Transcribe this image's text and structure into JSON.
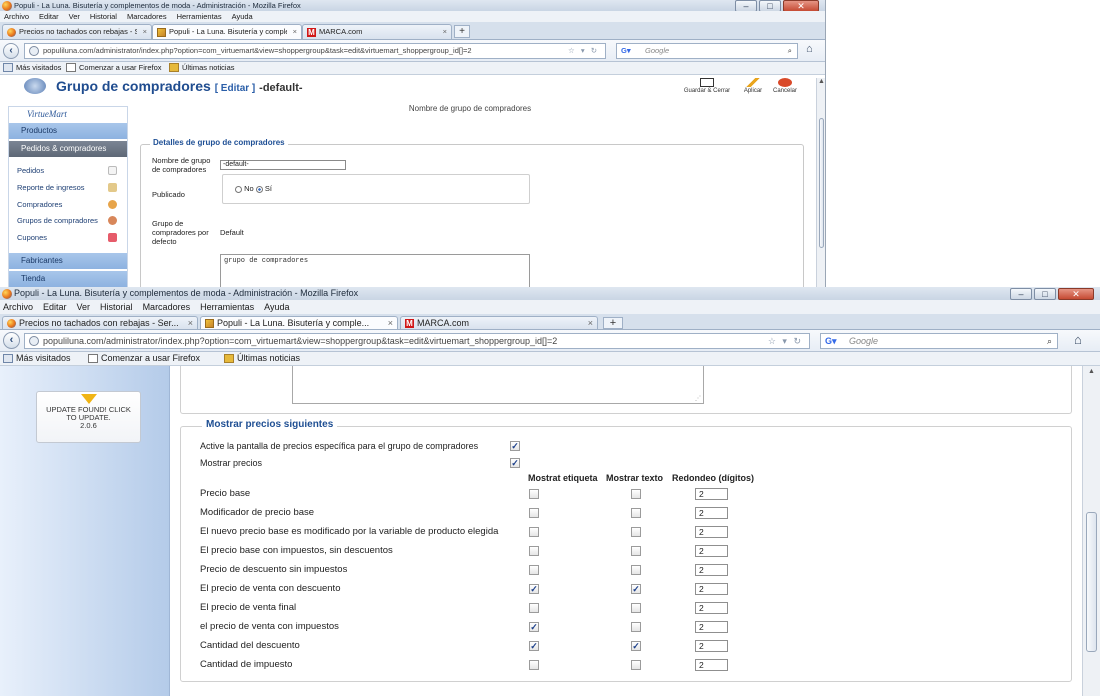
{
  "top_window": {
    "title": "Populi - La Luna. Bisutería y complementos de moda - Administración - Mozilla Firefox",
    "menu": [
      "Archivo",
      "Editar",
      "Ver",
      "Historial",
      "Marcadores",
      "Herramientas",
      "Ayuda"
    ],
    "tabs": [
      {
        "label": "Precios no tachados con rebajas - Ser...",
        "icon": "firefox-icon"
      },
      {
        "label": "Populi - La Luna. Bisutería y comple...",
        "icon": "image-icon"
      },
      {
        "label": "MARCA.com",
        "icon": "marca-icon"
      }
    ],
    "url": "populiluna.com/administrator/index.php?option=com_virtuemart&view=shoppergroup&task=edit&virtuemart_shoppergroup_id[]=2",
    "search_placeholder": "Google",
    "bookmarks": [
      "Más visitados",
      "Comenzar a usar Firefox",
      "Últimas noticias"
    ],
    "page_title": "Grupo de compradores",
    "page_title_edit": "[ Editar ]",
    "page_title_name": "-default-",
    "toolbar": [
      "Guardar & Cerrar",
      "Aplicar",
      "Cancelar"
    ],
    "sidebar": {
      "logo": "VirtueMart",
      "sections": [
        "Productos",
        "Pedidos & compradores",
        "Fabricantes",
        "Tienda"
      ],
      "links": [
        "Pedidos",
        "Reporte de ingresos",
        "Compradores",
        "Grupos de compradores",
        "Cupones"
      ]
    },
    "column_header": "Nombre de grupo de compradores",
    "fieldset_legend": "Detalles de grupo de compradores",
    "field_name_label": "Nombre de grupo de compradores",
    "field_name_value": "-default-",
    "published_label": "Publicado",
    "radio_no": "No",
    "radio_si": "Sí",
    "default_label": "Grupo de compradores por defecto",
    "default_value": "Default",
    "description_value": "grupo de compradores"
  },
  "bottom_window": {
    "title": "Populi - La Luna. Bisutería y complementos de moda - Administración - Mozilla Firefox",
    "menu": [
      "Archivo",
      "Editar",
      "Ver",
      "Historial",
      "Marcadores",
      "Herramientas",
      "Ayuda"
    ],
    "tabs": [
      {
        "label": "Precios no tachados con rebajas - Ser...",
        "icon": "firefox-icon"
      },
      {
        "label": "Populi - La Luna. Bisutería y comple...",
        "icon": "image-icon"
      },
      {
        "label": "MARCA.com",
        "icon": "marca-icon"
      }
    ],
    "url": "populiluna.com/administrator/index.php?option=com_virtuemart&view=shoppergroup&task=edit&virtuemart_shoppergroup_id[]=2",
    "search_placeholder": "Google",
    "bookmarks": [
      "Más visitados",
      "Comenzar a usar Firefox",
      "Últimas noticias"
    ],
    "update_box": [
      "UPDATE FOUND! CLICK",
      "TO UPDATE.",
      "2.0.6"
    ],
    "legend": "Mostrar precios siguientes",
    "activate_label": "Active la pantalla de precios específica para el grupo de compradores",
    "activate_checked": true,
    "show_prices_label": "Mostrar precios",
    "show_prices_checked": true,
    "col_headers": [
      "Mostrat etiqueta",
      "Mostrar texto",
      "Redondeo (dígitos)"
    ],
    "price_rows": [
      {
        "label": "Precio base",
        "etiqueta": false,
        "texto": false,
        "redondeo": "2"
      },
      {
        "label": "Modificador de precio base",
        "etiqueta": false,
        "texto": false,
        "redondeo": "2"
      },
      {
        "label": "El nuevo precio base es modificado por la variable de producto elegida",
        "etiqueta": false,
        "texto": false,
        "redondeo": "2"
      },
      {
        "label": "El precio base con impuestos, sin descuentos",
        "etiqueta": false,
        "texto": false,
        "redondeo": "2"
      },
      {
        "label": "Precio de descuento sin impuestos",
        "etiqueta": false,
        "texto": false,
        "redondeo": "2"
      },
      {
        "label": "El precio de venta con descuento",
        "etiqueta": true,
        "texto": true,
        "redondeo": "2"
      },
      {
        "label": "El precio de venta final",
        "etiqueta": false,
        "texto": false,
        "redondeo": "2"
      },
      {
        "label": "el precio de venta con impuestos",
        "etiqueta": true,
        "texto": false,
        "redondeo": "2"
      },
      {
        "label": "Cantidad del descuento",
        "etiqueta": true,
        "texto": true,
        "redondeo": "2"
      },
      {
        "label": "Cantidad de impuesto",
        "etiqueta": false,
        "texto": false,
        "redondeo": "2"
      }
    ]
  }
}
